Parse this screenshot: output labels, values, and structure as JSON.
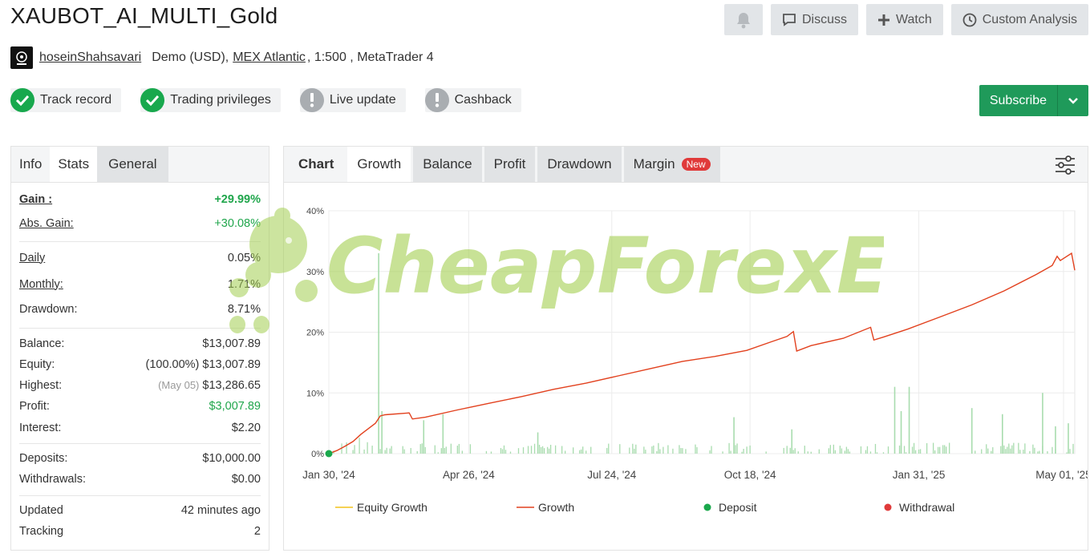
{
  "title": "XAUBOT_AI_MULTI_Gold",
  "top_buttons": {
    "discuss": "Discuss",
    "watch": "Watch",
    "custom_analysis": "Custom Analysis"
  },
  "account": {
    "user": "hoseinShahsavari",
    "type": "Demo (USD),",
    "broker": "MEX Atlantic",
    "details": ", 1:500 , MetaTrader 4"
  },
  "badges": [
    {
      "label": "Track record",
      "status": "ok"
    },
    {
      "label": "Trading privileges",
      "status": "ok"
    },
    {
      "label": "Live update",
      "status": "warn"
    },
    {
      "label": "Cashback",
      "status": "warn"
    }
  ],
  "subscribe_label": "Subscribe",
  "left_tabs": {
    "info": "Info",
    "stats": "Stats",
    "general": "General"
  },
  "stats": {
    "gain_label": "Gain :",
    "gain": "+29.99%",
    "abs_gain_label": "Abs. Gain:",
    "abs_gain": "+30.08%",
    "daily_label": "Daily",
    "daily": "0.05%",
    "monthly_label": "Monthly:",
    "monthly": "1.71%",
    "drawdown_label": "Drawdown:",
    "drawdown": "8.71%",
    "balance_label": "Balance:",
    "balance": "$13,007.89",
    "equity_label": "Equity:",
    "equity_pct": "(100.00%)",
    "equity": "$13,007.89",
    "highest_label": "Highest:",
    "highest_date": "(May 05)",
    "highest": "$13,286.65",
    "profit_label": "Profit:",
    "profit": "$3,007.89",
    "interest_label": "Interest:",
    "interest": "$2.20",
    "deposits_label": "Deposits:",
    "deposits": "$10,000.00",
    "withdrawals_label": "Withdrawals:",
    "withdrawals": "$0.00",
    "updated_label": "Updated",
    "updated": "42 minutes ago",
    "tracking_label": "Tracking",
    "tracking": "2"
  },
  "right_tabs": {
    "chart": "Chart",
    "growth": "Growth",
    "balance": "Balance",
    "profit": "Profit",
    "drawdown": "Drawdown",
    "margin": "Margin",
    "new_badge": "New"
  },
  "watermark": "CheapForexEa",
  "colors": {
    "growth": "#e2411e",
    "bars": "#a8dcae",
    "deposit": "#1aa84c",
    "withdrawal": "#e03a3a",
    "equity": "#f2c21a",
    "accent": "#1f9a5a"
  },
  "chart_data": {
    "type": "line",
    "ylim": [
      0,
      40
    ],
    "y_ticks": [
      "0%",
      "10%",
      "20%",
      "30%",
      "40%"
    ],
    "x_ticks": [
      "Jan 30, '24",
      "Apr 26, '24",
      "Jul 24, '24",
      "Oct 18, '24",
      "Jan 31, '25",
      "May 01, '25"
    ],
    "x_tick_days": [
      0,
      87,
      176,
      262,
      367,
      457
    ],
    "x_range_days": [
      0,
      464
    ],
    "grid": true,
    "legend_position": "bottom",
    "legend": [
      "Equity Growth",
      "Growth",
      "Deposit",
      "Withdrawal"
    ],
    "series": [
      {
        "name": "Growth",
        "points": [
          [
            0,
            0
          ],
          [
            5,
            0.5
          ],
          [
            10,
            1.2
          ],
          [
            15,
            2
          ],
          [
            20,
            3.2
          ],
          [
            25,
            4.2
          ],
          [
            29,
            5
          ],
          [
            32,
            6.2
          ],
          [
            35,
            6.4
          ],
          [
            50,
            6.7
          ],
          [
            52,
            5.7
          ],
          [
            60,
            6
          ],
          [
            80,
            7.2
          ],
          [
            100,
            8.3
          ],
          [
            120,
            9.4
          ],
          [
            140,
            10.6
          ],
          [
            160,
            11.6
          ],
          [
            180,
            12.8
          ],
          [
            200,
            14
          ],
          [
            220,
            15.2
          ],
          [
            240,
            16
          ],
          [
            260,
            17
          ],
          [
            275,
            18.4
          ],
          [
            285,
            19.3
          ],
          [
            289,
            20.1
          ],
          [
            291,
            16.9
          ],
          [
            300,
            17.8
          ],
          [
            320,
            19
          ],
          [
            337,
            20.8
          ],
          [
            339,
            18.7
          ],
          [
            345,
            19.2
          ],
          [
            360,
            20.5
          ],
          [
            380,
            22.5
          ],
          [
            400,
            24.5
          ],
          [
            420,
            26.8
          ],
          [
            440,
            29.5
          ],
          [
            450,
            31
          ],
          [
            453,
            32.5
          ],
          [
            455,
            31.8
          ],
          [
            462,
            33
          ],
          [
            464,
            30.2
          ]
        ]
      }
    ],
    "deposits": [
      [
        0,
        0
      ]
    ],
    "activity_bars": {
      "note": "per-day trading activity (percent scale)",
      "spikes": [
        [
          31,
          33
        ],
        [
          33,
          7
        ],
        [
          59,
          5.5
        ],
        [
          71,
          6.5
        ],
        [
          130,
          3.5
        ],
        [
          252,
          6
        ],
        [
          288,
          4
        ],
        [
          352,
          11
        ],
        [
          356,
          7
        ],
        [
          361,
          11
        ],
        [
          400,
          7.5
        ],
        [
          419,
          6.5
        ],
        [
          444,
          10
        ],
        [
          452,
          4.5
        ],
        [
          460,
          5
        ]
      ]
    }
  }
}
